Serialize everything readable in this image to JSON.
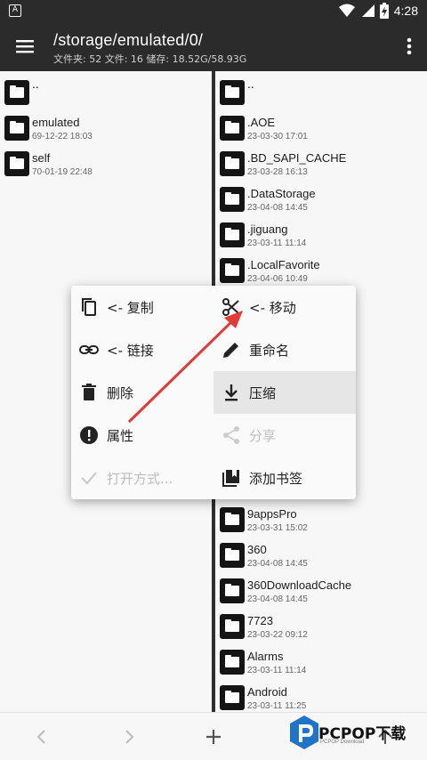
{
  "status_bar": {
    "time": "4:28",
    "app_icon_letter": "A"
  },
  "toolbar": {
    "path": "/storage/emulated/0/",
    "summary": "文件夹: 52  文件: 16  储存: 18.52G/58.93G"
  },
  "left_pane": {
    "items": [
      {
        "name": "..",
        "date": ""
      },
      {
        "name": "emulated",
        "date": "69-12-22 18:03"
      },
      {
        "name": "self",
        "date": "70-01-19 22:48"
      }
    ]
  },
  "right_pane": {
    "items": [
      {
        "name": "..",
        "date": ""
      },
      {
        "name": ".AOE",
        "date": "23-03-30 17:01"
      },
      {
        "name": ".BD_SAPI_CACHE",
        "date": "23-03-28 16:13"
      },
      {
        "name": ".DataStorage",
        "date": "23-04-08 14:45"
      },
      {
        "name": ".jiguang",
        "date": "23-03-11 11:14"
      },
      {
        "name": ".LocalFavorite",
        "date": "23-04-06 10:49"
      },
      {
        "name": "9appsPro",
        "date": "23-03-31 15:02"
      },
      {
        "name": "360",
        "date": "23-04-08 14:45"
      },
      {
        "name": "360DownloadCache",
        "date": "23-04-08 14:45"
      },
      {
        "name": "7723",
        "date": "23-03-22 09:12"
      },
      {
        "name": "Alarms",
        "date": "23-03-11 11:14"
      },
      {
        "name": "Android",
        "date": "23-03-11 11:25"
      }
    ]
  },
  "context_menu": {
    "copy": "<- 复制",
    "move": "<- 移动",
    "link": "<- 链接",
    "rename": "重命名",
    "delete": "删除",
    "compress": "压缩",
    "properties": "属性",
    "share": "分享",
    "open_with": "打开方式...",
    "bookmark": "添加书签"
  },
  "brand": {
    "name": "PCPOP下载",
    "sub": "PCPOP Download"
  },
  "colors": {
    "toolbar": "#2b2b2b",
    "annotation_arrow": "#e53935",
    "brand_blue": "#1f73c9"
  }
}
